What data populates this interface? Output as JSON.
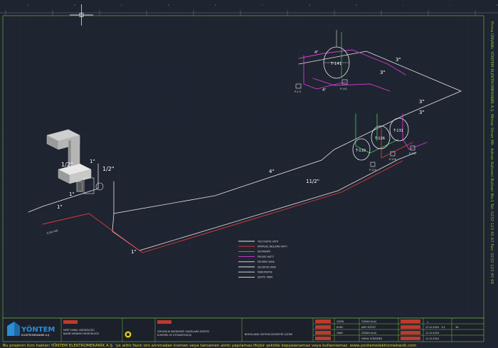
{
  "colors": {
    "background": "#1e2430",
    "grid": "#252c38",
    "pipe_white": "#e8e8e8",
    "pipe_magenta": "#d63cd6",
    "pipe_red": "#e03a3a",
    "pipe_green": "#3fbf4f",
    "border_green": "#7fbf3f",
    "footer_yellow": "#e6d21a",
    "company_blue": "#2a8fd8"
  },
  "top_ruler_digits": [
    "A",
    "B",
    "C",
    "D",
    "E",
    "F",
    "G",
    "H",
    "I",
    "J",
    "K"
  ],
  "pipe_sizes": {
    "tank141_in": "4\"",
    "tank141_out": "4\"",
    "main_right_upper": "3\"",
    "main_right_mid": "3\"",
    "right_col_1": "3\"",
    "right_col_2": "3\"",
    "riser_left_top": "1/2\"",
    "riser_left_right": "1/2\"",
    "riser_small": "1\"",
    "feed_mid": "1\"",
    "feed_left": "1\"",
    "long_run": "4\"",
    "diagonal_run": "11/2\"",
    "bottom_run": "1\""
  },
  "tanks": [
    {
      "id": "T-141",
      "label": "T-141"
    },
    {
      "id": "T-126",
      "label": "T-126"
    },
    {
      "id": "T-131",
      "label": "T-131"
    },
    {
      "id": "T-110",
      "label": "T-110"
    }
  ],
  "pumps": [
    {
      "label": "P-141"
    },
    {
      "label": "P-2.0"
    },
    {
      "label": "P-110"
    },
    {
      "label": "P-126"
    },
    {
      "label": "P-131"
    }
  ],
  "legend": [
    {
      "label": "YÜZ FISKIYE HATTI",
      "color": "#e8e8e8"
    },
    {
      "label": "KIMYASAL BESLEME HATTI",
      "color": "#e03a3a"
    },
    {
      "label": "DEVIRDAIM",
      "color": "#3fbf4f"
    },
    {
      "label": "PROSES HATTI",
      "color": "#d63cd6"
    },
    {
      "label": "KELEBEK VANA",
      "color": "#e8e8e8"
    },
    {
      "label": "SELENOID VANA",
      "color": "#e8e8e8"
    },
    {
      "label": "MANOMETRE",
      "color": "#e8e8e8"
    },
    {
      "label": "SEVIYE TANKI",
      "color": "#e8e8e8"
    }
  ],
  "small_annotation": "G.SU HAT",
  "title_block": {
    "company_name": "YÖNTEM",
    "company_sub": "ELEKTROMEKANİK A.Ş.",
    "client_line1": "MERT GENEL MÜDÜRLÜĞÜ",
    "client_line2": "BAKIM YARDIMCI MÜDÜRLÜĞÜ",
    "project_line1": "YÜKSEKLİK KARBONİZE HAZIRLAMA ÜNİTESİ",
    "project_line2": "ELEKTRİK VE OTOMASYON İŞİ",
    "drawing_title": "BORULAMA SİSTEMİ İZOMETRİ ÇİZİMİ",
    "rev_rows": [
      {
        "label": "ÇİZEN",
        "name": "ÖZKAN ALAÇ",
        "date": "12.10.2016"
      },
      {
        "label": "KONT.",
        "name": "ARİF SÖĞÜT",
        "date": "12.10.2016"
      },
      {
        "label": "ONAY",
        "name": "ÖZKAN ALAÇ",
        "date": "12.10.2016"
      },
      {
        "label": "",
        "name": "FARUK GÖKDENİZ",
        "date": ""
      }
    ],
    "sheet_no": "1",
    "sheet_total": "36",
    "scale": "1/1"
  },
  "footer_text": "Bu projenin tüm hakları YÖNTEM ELEKTROMEKANİK A.Ş. 'ye aittir.Yazılı izin alınmadan kısmen veya tamamen alıntı yapılamaz.Hiçbir şekilde kopyalanamaz veya kullanılamaz.   www.yontemelektromekanik.com",
  "side_text": "Firma ÜNVANI: YÖNTEM ELEKTROMEKANİK A.Ş. Mimar Sinan Mh. Adnan Kahveci Bulvarı No:1 Tel: 0232 123 45 67 Fax: 0232 123 45 68"
}
